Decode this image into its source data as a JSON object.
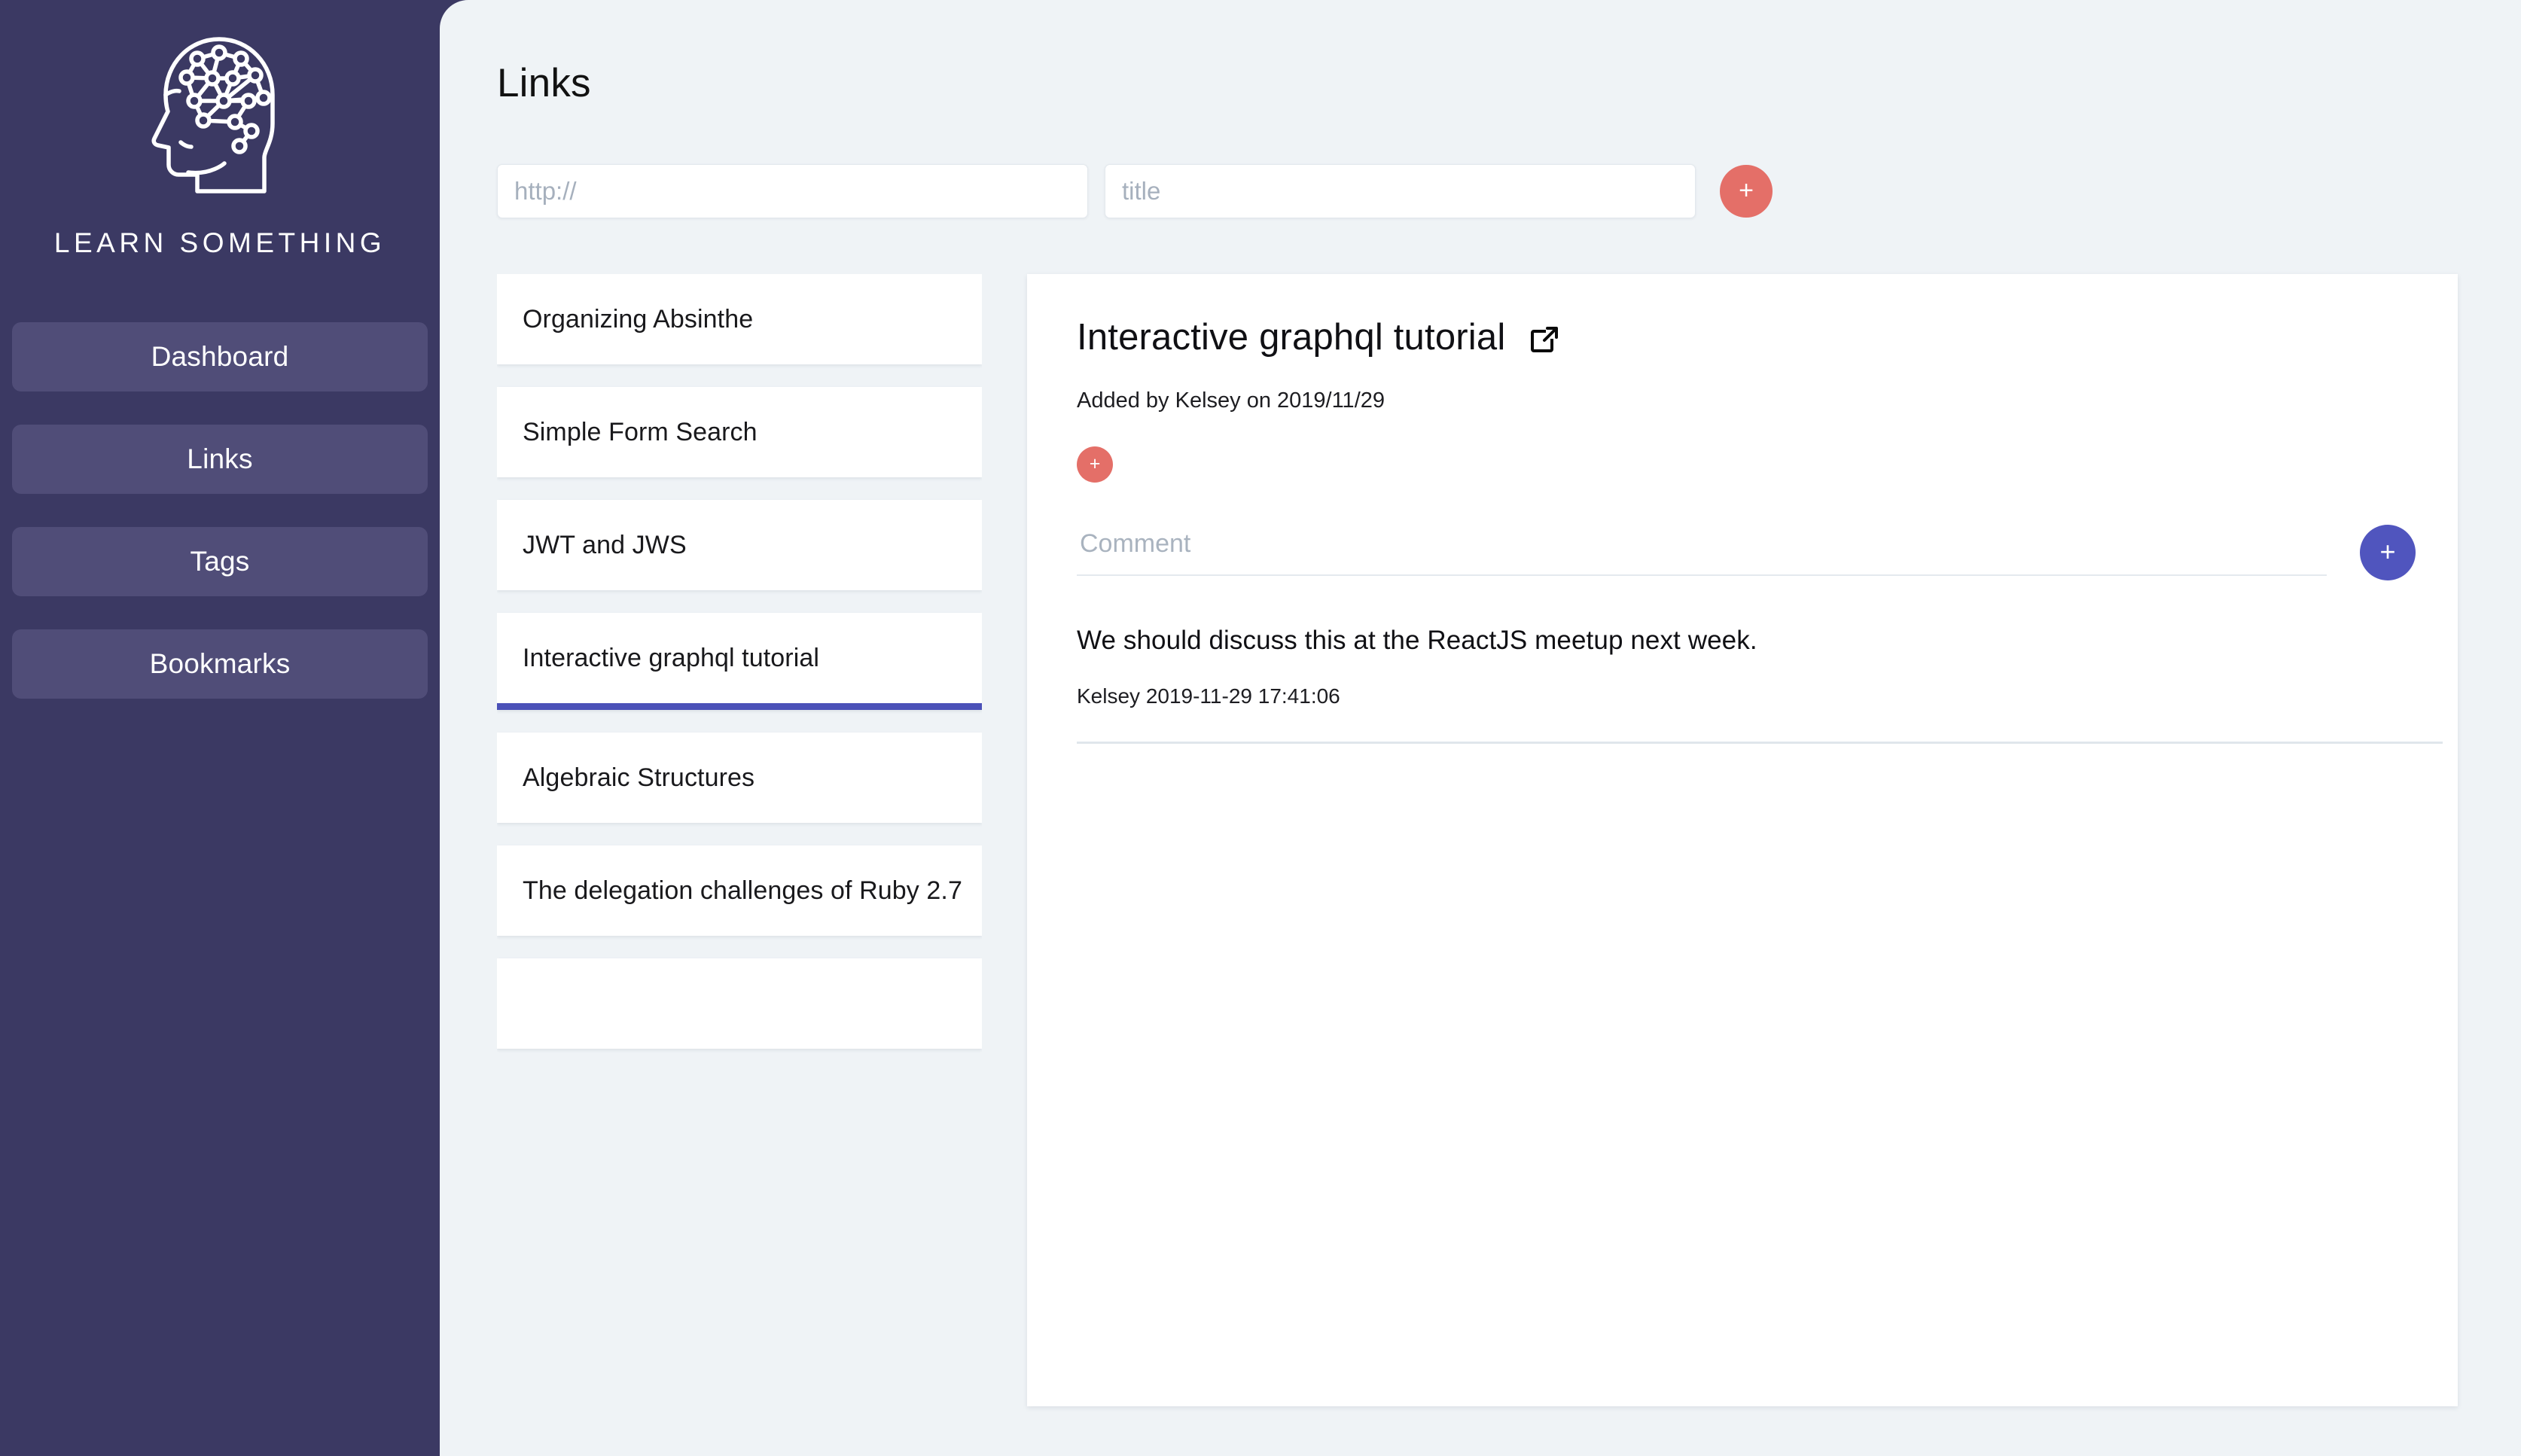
{
  "brand": {
    "name": "LEARN SOMETHING",
    "logo_icon": "head-brain-network-icon"
  },
  "sidebar": {
    "items": [
      {
        "label": "Dashboard",
        "name": "dashboard"
      },
      {
        "label": "Links",
        "name": "links"
      },
      {
        "label": "Tags",
        "name": "tags"
      },
      {
        "label": "Bookmarks",
        "name": "bookmarks"
      }
    ]
  },
  "page": {
    "title": "Links"
  },
  "add_link_form": {
    "url_placeholder": "http://",
    "url_value": "",
    "title_placeholder": "title",
    "title_value": "",
    "submit_label": "+"
  },
  "link_list": {
    "items": [
      {
        "title": "Organizing Absinthe",
        "active": false
      },
      {
        "title": "Simple Form Search",
        "active": false
      },
      {
        "title": "JWT and JWS",
        "active": false
      },
      {
        "title": "Interactive graphql tutorial",
        "active": true
      },
      {
        "title": "Algebraic Structures",
        "active": false
      },
      {
        "title": "The delegation challenges of Ruby 2.7",
        "active": false
      },
      {
        "title": "",
        "active": false
      }
    ]
  },
  "detail": {
    "title": "Interactive graphql tutorial",
    "external_link_icon": "external-link-icon",
    "meta": "Added by Kelsey on 2019/11/29",
    "add_tag_label": "+",
    "comment_placeholder": "Comment",
    "comment_value": "",
    "submit_comment_label": "+",
    "comments": [
      {
        "body": "We should discuss this at the ReactJS meetup next week.",
        "byline": "Kelsey 2019-11-29 17:41:06"
      }
    ]
  },
  "colors": {
    "sidebar_bg": "#3b3963",
    "sidebar_button_bg": "#504d78",
    "content_bg": "#eff3f6",
    "accent_red": "#e46f68",
    "accent_blue": "#5055be",
    "active_underline": "#4b51b8",
    "card_bg": "#ffffff"
  }
}
